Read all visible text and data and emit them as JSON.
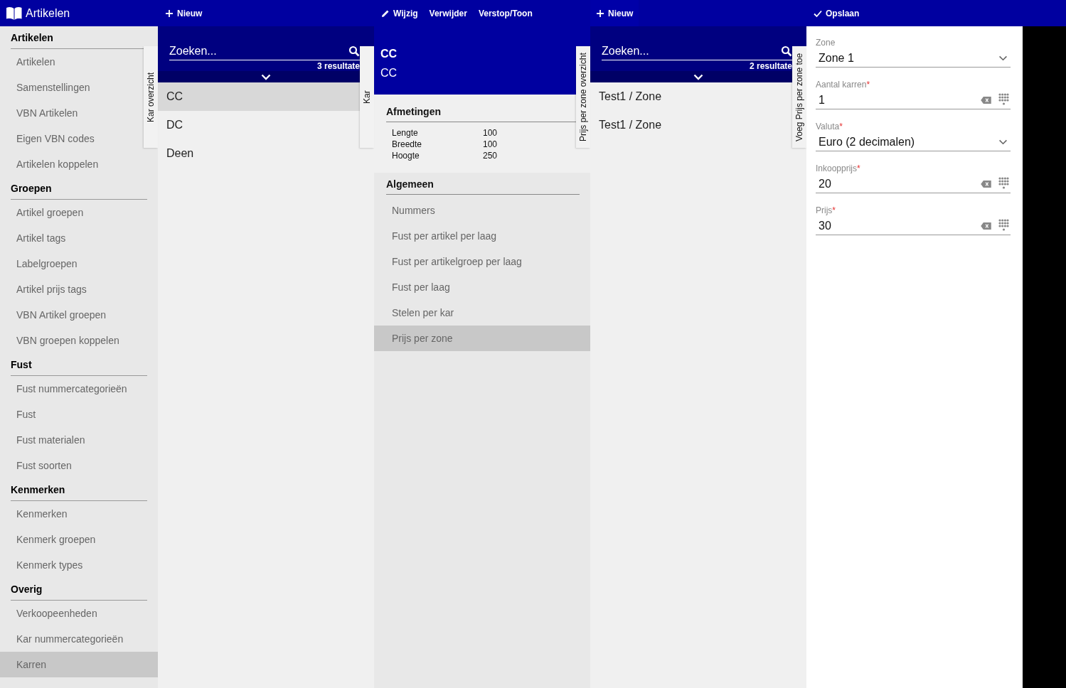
{
  "app_title": "Artikelen",
  "sidebar": {
    "groups": [
      {
        "title": "Artikelen",
        "items": [
          {
            "label": "Artikelen",
            "selected": false
          },
          {
            "label": "Samenstellingen",
            "selected": false
          },
          {
            "label": "VBN Artikelen",
            "selected": false
          },
          {
            "label": "Eigen VBN codes",
            "selected": false
          },
          {
            "label": "Artikelen koppelen",
            "selected": false
          }
        ]
      },
      {
        "title": "Groepen",
        "items": [
          {
            "label": "Artikel groepen",
            "selected": false
          },
          {
            "label": "Artikel tags",
            "selected": false
          },
          {
            "label": "Labelgroepen",
            "selected": false
          },
          {
            "label": "Artikel prijs tags",
            "selected": false
          },
          {
            "label": "VBN Artikel groepen",
            "selected": false
          },
          {
            "label": "VBN groepen koppelen",
            "selected": false
          }
        ]
      },
      {
        "title": "Fust",
        "items": [
          {
            "label": "Fust nummercategorieën",
            "selected": false
          },
          {
            "label": "Fust",
            "selected": false
          },
          {
            "label": "Fust materialen",
            "selected": false
          },
          {
            "label": "Fust soorten",
            "selected": false
          }
        ]
      },
      {
        "title": "Kenmerken",
        "items": [
          {
            "label": "Kenmerken",
            "selected": false
          },
          {
            "label": "Kenmerk groepen",
            "selected": false
          },
          {
            "label": "Kenmerk types",
            "selected": false
          }
        ]
      },
      {
        "title": "Overig",
        "items": [
          {
            "label": "Verkoopeenheden",
            "selected": false
          },
          {
            "label": "Kar nummercategorieën",
            "selected": false
          },
          {
            "label": "Karren",
            "selected": true
          }
        ]
      }
    ]
  },
  "kar_list": {
    "side_tab": "Kar overzicht",
    "toolbar": [
      {
        "kind": "add",
        "label": "Nieuw"
      }
    ],
    "search": {
      "placeholder": "Zoeken..."
    },
    "result_count": "3 resultate",
    "items": [
      {
        "label": "CC",
        "selected": true
      },
      {
        "label": "DC",
        "selected": false
      },
      {
        "label": "Deen",
        "selected": false
      }
    ]
  },
  "kar_detail": {
    "side_tab": "Kar",
    "toolbar": [
      {
        "kind": "edit",
        "label": "Wijzig"
      },
      {
        "kind": "text",
        "label": "Verwijder"
      },
      {
        "kind": "text",
        "label": "Verstop/Toon"
      }
    ],
    "title": "CC",
    "subtitle": "CC",
    "dimensions": {
      "heading": "Afmetingen",
      "rows": [
        {
          "label": "Lengte",
          "value": "100"
        },
        {
          "label": "Breedte",
          "value": "100"
        },
        {
          "label": "Hoogte",
          "value": "250"
        }
      ]
    },
    "general": {
      "heading": "Algemeen",
      "items": [
        {
          "label": "Nummers",
          "selected": false
        },
        {
          "label": "Fust per artikel per laag",
          "selected": false
        },
        {
          "label": "Fust per artikelgroep per laag",
          "selected": false
        },
        {
          "label": "Fust per laag",
          "selected": false
        },
        {
          "label": "Stelen per kar",
          "selected": false
        },
        {
          "label": "Prijs per zone",
          "selected": true
        }
      ]
    }
  },
  "zone_list": {
    "side_tab": "Prijs per zone overzicht",
    "toolbar": [
      {
        "kind": "add",
        "label": "Nieuw"
      }
    ],
    "search": {
      "placeholder": "Zoeken..."
    },
    "result_count": "2 resultate",
    "items": [
      {
        "label": "Test1 / Zone",
        "selected": false
      },
      {
        "label": "Test1 / Zone",
        "selected": false
      }
    ]
  },
  "zone_form": {
    "side_tab": "Voeg Prijs per zone toe",
    "toolbar": [
      {
        "kind": "save",
        "label": "Opslaan"
      }
    ],
    "fields": [
      {
        "kind": "select",
        "label": "Zone",
        "value": "Zone 1"
      },
      {
        "kind": "number",
        "label": "Aantal karren",
        "required_mark": "*",
        "value": "1"
      },
      {
        "kind": "select",
        "label": "Valuta",
        "required_mark": "*",
        "value": "Euro (2 decimalen)"
      },
      {
        "kind": "number",
        "label": "Inkoopprijs",
        "required_mark": "*",
        "value": "20"
      },
      {
        "kind": "number",
        "label": "Prijs",
        "required_mark": "*",
        "value": "30"
      }
    ]
  }
}
